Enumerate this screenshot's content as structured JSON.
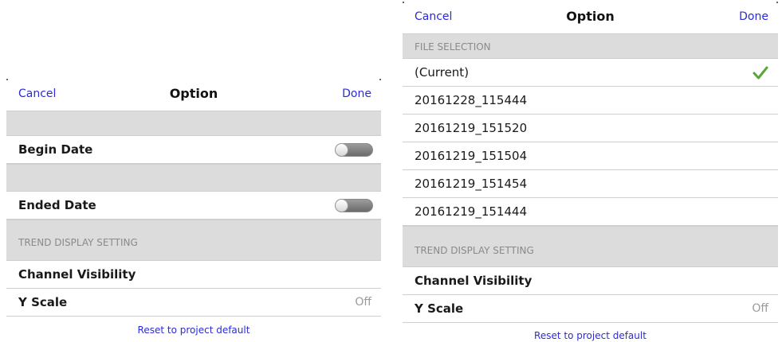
{
  "left": {
    "nav": {
      "cancel": "Cancel",
      "title": "Option",
      "done": "Done"
    },
    "rows": {
      "begin_date": "Begin Date",
      "ended_date": "Ended Date",
      "channel_visibility": "Channel Visibility",
      "y_scale": "Y Scale",
      "y_scale_value": "Off"
    },
    "section_trend": "TREND DISPLAY SETTING",
    "begin_toggle_on": false,
    "ended_toggle_on": false,
    "reset": "Reset to project default"
  },
  "right": {
    "nav": {
      "cancel": "Cancel",
      "title": "Option",
      "done": "Done"
    },
    "section_file": "FILE SELECTION",
    "files": [
      "(Current)",
      "20161228_115444",
      "20161219_151520",
      "20161219_151504",
      "20161219_151454",
      "20161219_151444"
    ],
    "selected_file": "(Current)",
    "section_trend": "TREND DISPLAY SETTING",
    "rows": {
      "channel_visibility": "Channel Visibility",
      "y_scale": "Y Scale",
      "y_scale_value": "Off"
    },
    "reset": "Reset to project default"
  },
  "colors": {
    "link": "#2b2bd8",
    "section_bg": "#dcdcdc",
    "checkmark": "#5aa63c"
  }
}
